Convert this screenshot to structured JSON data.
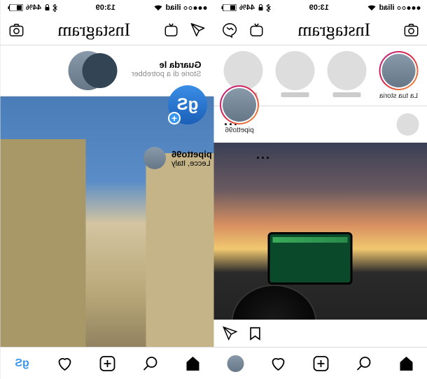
{
  "status": {
    "carrier": "iliad",
    "time": "13:09",
    "battery": "44%",
    "signal_icon": "signal-dots",
    "wifi_icon": "wifi-icon",
    "bluetooth_icon": "bluetooth-icon",
    "lock_icon": "lock-icon",
    "battery_icon": "battery-icon"
  },
  "header": {
    "logo_text": "Instagram",
    "camera_icon": "camera-icon",
    "igtv_icon": "igtv-icon",
    "dm_icon": "paper-plane-icon",
    "messenger_icon": "messenger-icon"
  },
  "left_screen": {
    "watch_all": {
      "title": "Guarda le",
      "subtitle": "Storie di a\npotrebber"
    },
    "stories": [
      {
        "label": "",
        "type": "cluster"
      }
    ],
    "bottom_nav": {
      "home_icon": "home-icon",
      "search_icon": "search-icon",
      "add_icon": "add-post-icon",
      "heart_icon": "heart-icon",
      "profile_gs": "gS"
    }
  },
  "right_screen": {
    "stories": [
      {
        "label": "La tua storia",
        "type": "your-story"
      },
      {
        "label": "",
        "type": "placeholder"
      },
      {
        "label": "",
        "type": "placeholder"
      },
      {
        "label": "",
        "type": "placeholder"
      }
    ],
    "post": {
      "username": "",
      "location": "",
      "more": "···"
    },
    "bottom_nav": {
      "home_icon": "home-icon",
      "search_icon": "search-icon",
      "add_icon": "add-post-icon",
      "heart_icon": "heart-icon"
    }
  },
  "center_screen": {
    "stories": [
      {
        "label": "pipetto96",
        "type": "user-ring"
      },
      {
        "label": "",
        "type": "blue-gs"
      }
    ],
    "post": {
      "username": "pipetto96",
      "location": "Lecce, Italy",
      "more": "···"
    }
  },
  "icons": {
    "camera": "camera",
    "igtv": "igtv",
    "dm": "dm",
    "home": "home",
    "search": "search",
    "add": "add",
    "heart": "heart",
    "bookmark": "bookmark",
    "comment": "comment",
    "share": "share"
  }
}
